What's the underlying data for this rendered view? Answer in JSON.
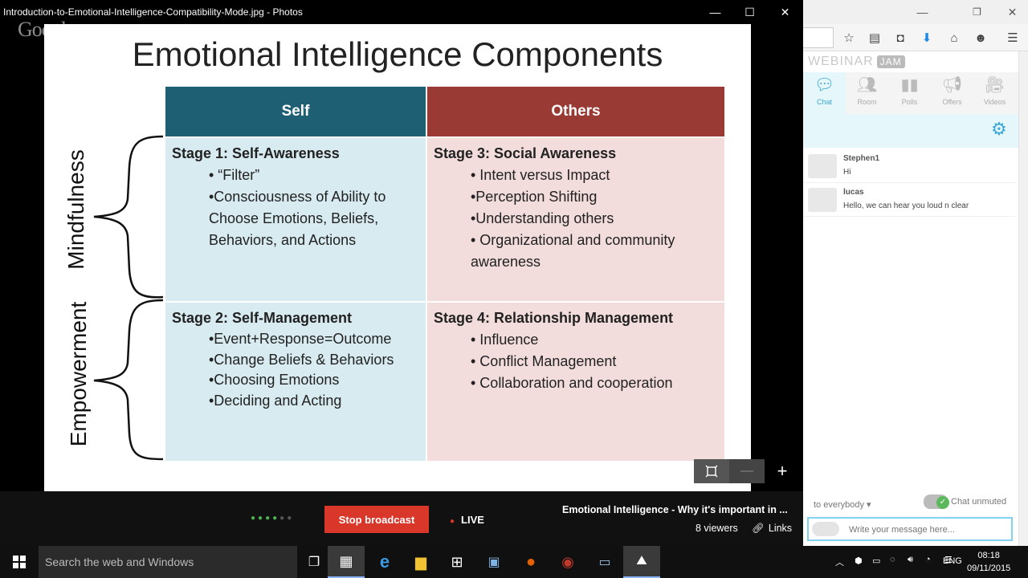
{
  "window": {
    "title": "Introduction-to-Emotional-Intelligence-Compatibility-Mode.jpg - Photos",
    "minimize": "—",
    "maximize": "☐",
    "close": "✕"
  },
  "watermark": "Google",
  "slide": {
    "title": "Emotional Intelligence Components",
    "col_self": "Self",
    "col_others": "Others",
    "row_top": "Mindfulness",
    "row_bottom": "Empowerment",
    "colors": {
      "self_header": "#1e5f74",
      "others_header": "#9a3a34",
      "self_cell": "#d7ebf1",
      "others_cell": "#f2dcdc"
    },
    "stage1": {
      "title": "Stage 1: Self-Awareness",
      "items": [
        "• “Filter”",
        "•Consciousness of Ability to",
        "Choose Emotions, Beliefs,",
        "Behaviors, and Actions"
      ]
    },
    "stage2": {
      "title": "Stage 2: Self-Management",
      "items": [
        "•Event+Response=Outcome",
        "•Change Beliefs & Behaviors",
        "•Choosing Emotions",
        "•Deciding and Acting"
      ]
    },
    "stage3": {
      "title": "Stage 3: Social Awareness",
      "items": [
        "• Intent versus Impact",
        "•Perception Shifting",
        "•Understanding others",
        "•  Organizational and community",
        "awareness"
      ]
    },
    "stage4": {
      "title": "Stage 4: Relationship Management",
      "items": [
        "• Influence",
        "• Conflict Management",
        "• Collaboration and cooperation"
      ]
    }
  },
  "broadcast": {
    "stop_label": "Stop broadcast",
    "live_label": "LIVE",
    "title": "Emotional Intelligence - Why it's important in ...",
    "viewers": "8 viewers",
    "links": "Links"
  },
  "webinar": {
    "logo": "WEBINAR",
    "logo_badge": "JAM",
    "tabs": [
      {
        "label": "Chat",
        "icon": "chat-icon"
      },
      {
        "label": "Room",
        "icon": "room-icon"
      },
      {
        "label": "Polls",
        "icon": "polls-icon"
      },
      {
        "label": "Offers",
        "icon": "offers-icon"
      },
      {
        "label": "Videos",
        "icon": "videos-icon"
      }
    ],
    "messages": [
      {
        "name": "Stephen1",
        "text": "Hi"
      },
      {
        "name": "lucas",
        "text": "Hello, we can hear you loud n clear"
      }
    ],
    "recipient": "to everybody",
    "chat_status": "Chat unmuted",
    "input_placeholder": "Write your message here..."
  },
  "taskbar": {
    "search_placeholder": "Search the web and Windows",
    "lang": "ENG",
    "time": "08:18",
    "date": "09/11/2015"
  }
}
